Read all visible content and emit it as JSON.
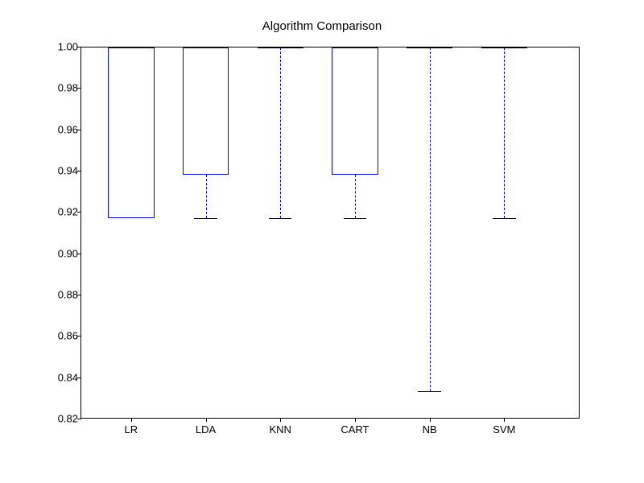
{
  "chart_data": {
    "type": "boxplot",
    "title": "Algorithm Comparison",
    "xlabel": "",
    "ylabel": "",
    "ylim": [
      0.82,
      1.0
    ],
    "yticks": [
      0.82,
      0.84,
      0.86,
      0.88,
      0.9,
      0.92,
      0.94,
      0.96,
      0.98,
      1.0
    ],
    "categories": [
      "LR",
      "LDA",
      "KNN",
      "CART",
      "NB",
      "SVM"
    ],
    "series": [
      {
        "name": "LR",
        "q1": 0.917,
        "median": 1.0,
        "q3": 1.0,
        "whisker_low": 0.917,
        "whisker_high": 1.0
      },
      {
        "name": "LDA",
        "q1": 0.938,
        "median": 1.0,
        "q3": 1.0,
        "whisker_low": 0.917,
        "whisker_high": 1.0
      },
      {
        "name": "KNN",
        "q1": 1.0,
        "median": 1.0,
        "q3": 1.0,
        "whisker_low": 0.917,
        "whisker_high": 1.0
      },
      {
        "name": "CART",
        "q1": 0.938,
        "median": 1.0,
        "q3": 1.0,
        "whisker_low": 0.917,
        "whisker_high": 1.0
      },
      {
        "name": "NB",
        "q1": 1.0,
        "median": 1.0,
        "q3": 1.0,
        "whisker_low": 0.833,
        "whisker_high": 1.0
      },
      {
        "name": "SVM",
        "q1": 1.0,
        "median": 1.0,
        "q3": 1.0,
        "whisker_low": 0.917,
        "whisker_high": 1.0
      }
    ]
  }
}
